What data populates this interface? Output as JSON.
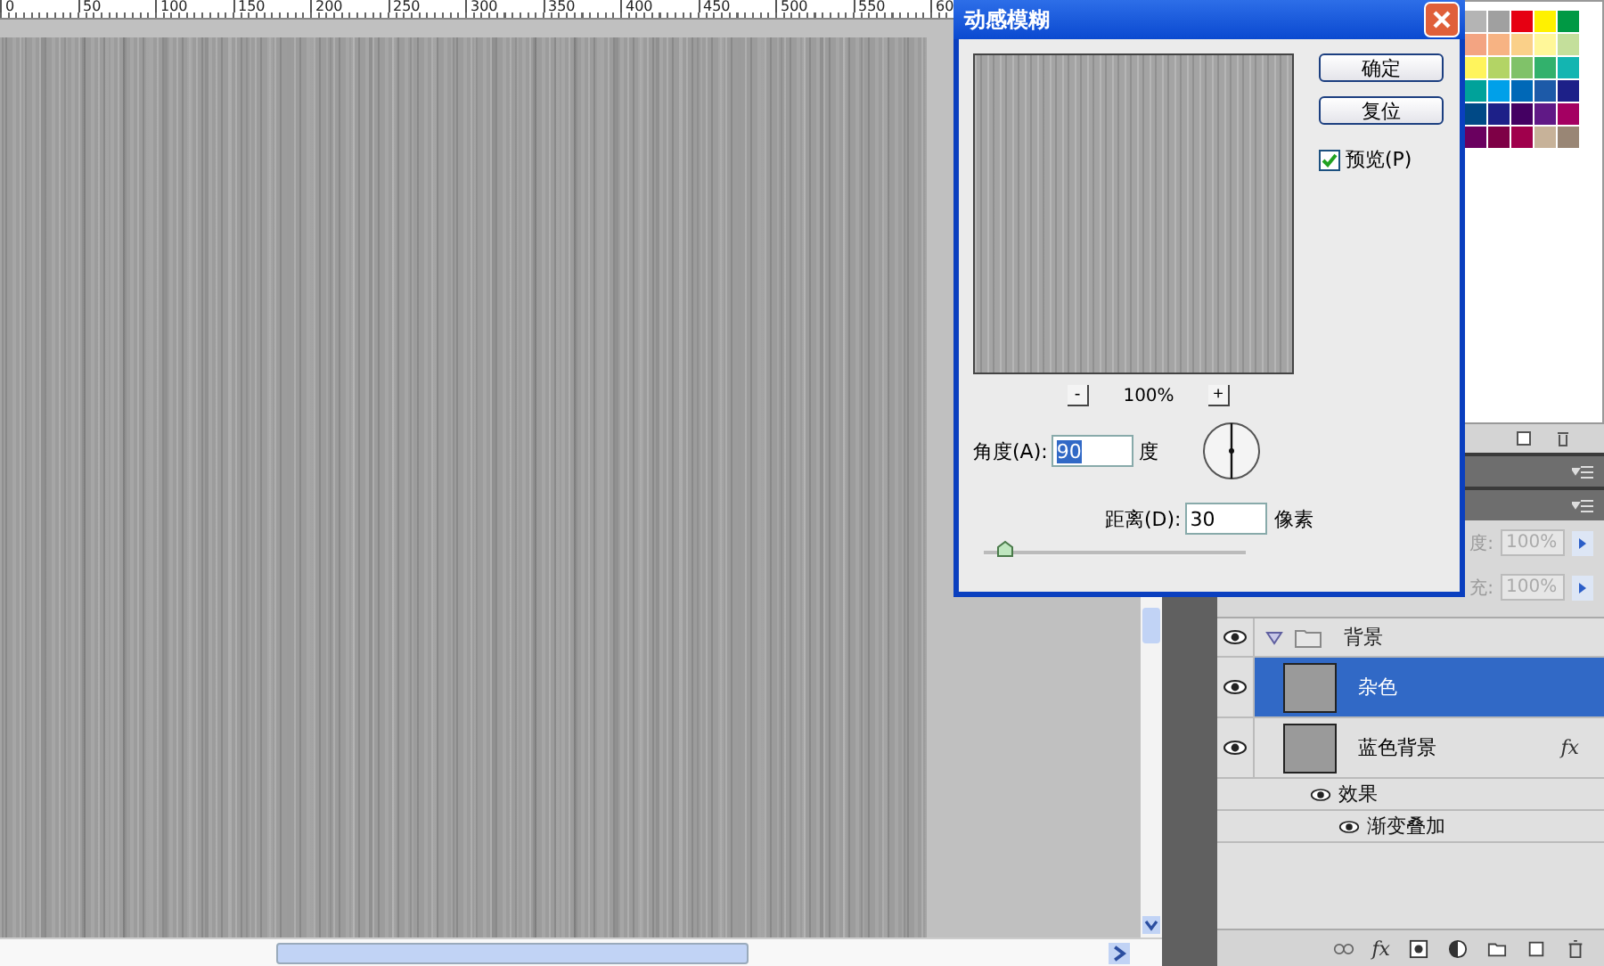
{
  "ruler": {
    "labels": [
      "0",
      "50",
      "100",
      "150",
      "200",
      "250",
      "300",
      "350",
      "400",
      "450",
      "500",
      "550",
      "60"
    ]
  },
  "swatches": [
    {
      "color": "#b4b4b4"
    },
    {
      "color": "#a0a0a0"
    },
    {
      "color": "#e60012"
    },
    {
      "color": "#fff100"
    },
    {
      "color": "#009944"
    },
    {
      "color": "#f3a482"
    },
    {
      "color": "#f7b383"
    },
    {
      "color": "#fad089"
    },
    {
      "color": "#fff799"
    },
    {
      "color": "#c4df9b"
    },
    {
      "color": "#fff45c"
    },
    {
      "color": "#b3d465"
    },
    {
      "color": "#80c269"
    },
    {
      "color": "#32b16c"
    },
    {
      "color": "#13b5b1"
    },
    {
      "color": "#00a29a"
    },
    {
      "color": "#00a0e9"
    },
    {
      "color": "#0068b7"
    },
    {
      "color": "#1d5aa8"
    },
    {
      "color": "#1d2088"
    },
    {
      "color": "#004986"
    },
    {
      "color": "#1d2088"
    },
    {
      "color": "#440062"
    },
    {
      "color": "#601986"
    },
    {
      "color": "#a40062"
    },
    {
      "color": "#6a005f"
    },
    {
      "color": "#7e0046"
    },
    {
      "color": "#a0004c"
    },
    {
      "color": "#c7b299"
    },
    {
      "color": "#998675"
    }
  ],
  "layers_panel": {
    "opacity_label": "度:",
    "opacity_value": "100%",
    "fill_label": "充:",
    "fill_value": "100%",
    "toolbar_fx": "fx",
    "layers": [
      {
        "kind": "group",
        "name": "背景",
        "visible": true,
        "expanded": true,
        "children": [
          {
            "kind": "layer",
            "name": "杂色",
            "visible": true,
            "selected": true
          },
          {
            "kind": "layer",
            "name": "蓝色背景",
            "visible": true,
            "selected": false,
            "fx": "fx",
            "children": [
              {
                "kind": "effects",
                "name": "效果",
                "visible": true,
                "children": [
                  {
                    "kind": "effect",
                    "name": "渐变叠加",
                    "visible": true
                  }
                ]
              }
            ]
          }
        ]
      }
    ]
  },
  "dialog": {
    "title": "动感模糊",
    "buttons": [
      "确定",
      "复位"
    ],
    "preview": {
      "label": "预览(P)",
      "checked": true
    },
    "zoom": {
      "minus": "-",
      "value": "100%",
      "plus": "+"
    },
    "angle": {
      "label": "角度(A):",
      "value": "90",
      "unit": "度"
    },
    "distance": {
      "label": "距离(D):",
      "value": "30",
      "unit": "像素",
      "level": 0.08
    }
  }
}
